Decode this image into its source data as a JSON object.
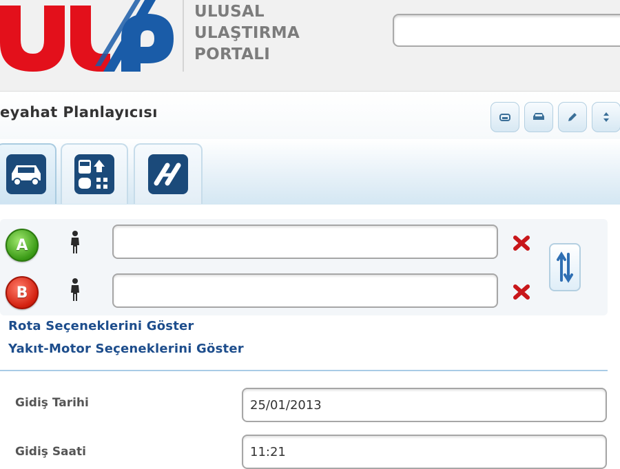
{
  "header": {
    "logo_text": "UUP",
    "portal_name": [
      "ULUSAL",
      "ULAŞTIRMA",
      "PORTALI"
    ],
    "search": {
      "value": "",
      "placeholder": ""
    }
  },
  "titlebar": {
    "title": "eyahat Planlayıcısı",
    "tools": [
      "printer-icon",
      "car-save-icon",
      "pencil-icon",
      "arrows-icon"
    ]
  },
  "tabs": [
    {
      "icon": "car-icon",
      "active": true
    },
    {
      "icon": "public-transport-icon",
      "active": false
    },
    {
      "icon": "route-link-icon",
      "active": false
    }
  ],
  "route": {
    "origin": {
      "marker": "A",
      "value": "",
      "placeholder": ""
    },
    "destination": {
      "marker": "B",
      "value": "",
      "placeholder": ""
    }
  },
  "links": {
    "route_options": "Rota Seçeneklerini Göster",
    "fuel_engine_options": "Yakıt-Motor Seçeneklerini Göster"
  },
  "form": {
    "date_label": "Gidiş Tarihi",
    "date_value": "25/01/2013",
    "time_label": "Gidiş Saati",
    "time_value": "11:21"
  },
  "colors": {
    "brand_red": "#e3101b",
    "brand_blue": "#1a5ca8",
    "link_blue": "#1d4d8c",
    "marker_a": "#3a9a16",
    "marker_b": "#d2200f",
    "clear_red": "#c8171b"
  }
}
